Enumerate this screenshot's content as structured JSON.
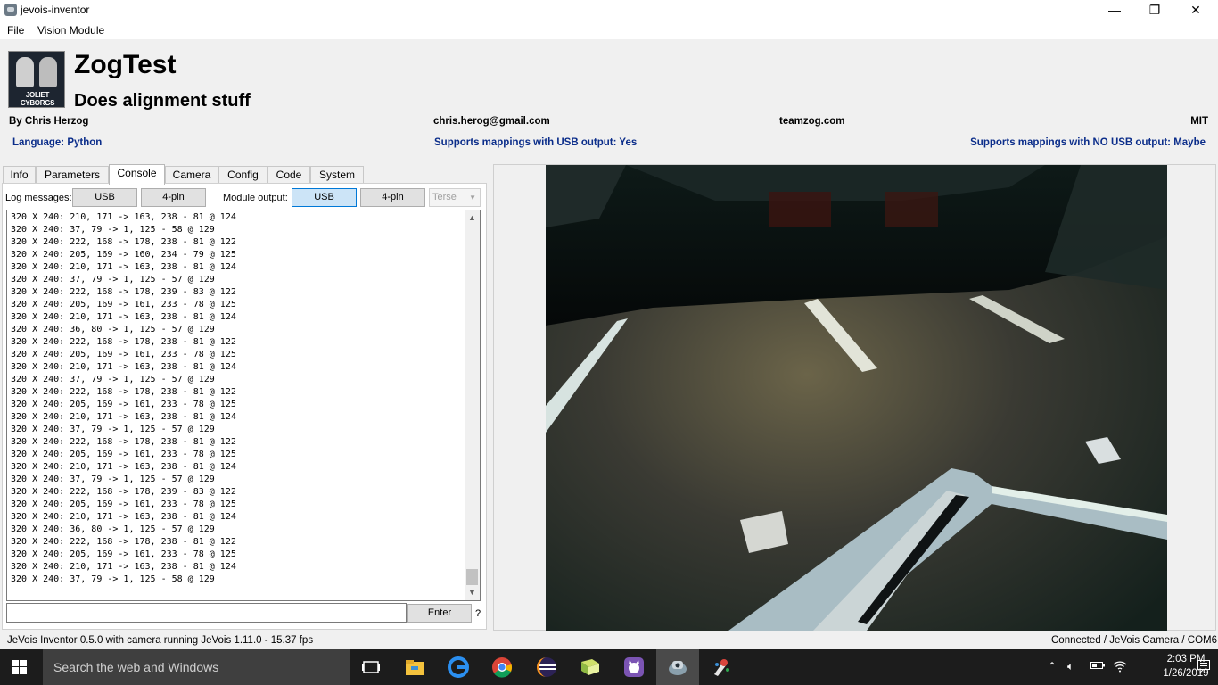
{
  "window": {
    "title": "jevois-inventor",
    "minimize": "—",
    "restore": "❐",
    "close": "✕"
  },
  "menu": [
    "File",
    "Vision Module"
  ],
  "module": {
    "name": "ZogTest",
    "description": "Does alignment stuff",
    "logo_text": "JOLIET CYBORGS",
    "author": "By Chris Herzog",
    "email": "chris.herog@gmail.com",
    "website": "teamzog.com",
    "license": "MIT",
    "language": "Language: Python",
    "usb_mappings": "Supports mappings with USB output: Yes",
    "nousb_mappings": "Supports mappings with NO USB output: Maybe"
  },
  "tabs": [
    "Info",
    "Parameters",
    "Console",
    "Camera",
    "Config",
    "Code",
    "System"
  ],
  "active_tab": "Console",
  "console": {
    "log_messages_label": "Log messages:",
    "log_usb": "USB",
    "log_4pin": "4-pin",
    "module_output_label": "Module output:",
    "out_usb": "USB",
    "out_4pin": "4-pin",
    "terse": "Terse",
    "lines": [
      "320 X 240: 210, 171 -> 163, 238 - 81 @ 124",
      "320 X 240: 37, 79 -> 1, 125 - 58 @ 129",
      "320 X 240: 222, 168 -> 178, 238 - 81 @ 122",
      "320 X 240: 205, 169 -> 160, 234 - 79 @ 125",
      "320 X 240: 210, 171 -> 163, 238 - 81 @ 124",
      "320 X 240: 37, 79 -> 1, 125 - 57 @ 129",
      "320 X 240: 222, 168 -> 178, 239 - 83 @ 122",
      "320 X 240: 205, 169 -> 161, 233 - 78 @ 125",
      "320 X 240: 210, 171 -> 163, 238 - 81 @ 124",
      "320 X 240: 36, 80 -> 1, 125 - 57 @ 129",
      "320 X 240: 222, 168 -> 178, 238 - 81 @ 122",
      "320 X 240: 205, 169 -> 161, 233 - 78 @ 125",
      "320 X 240: 210, 171 -> 163, 238 - 81 @ 124",
      "320 X 240: 37, 79 -> 1, 125 - 57 @ 129",
      "320 X 240: 222, 168 -> 178, 238 - 81 @ 122",
      "320 X 240: 205, 169 -> 161, 233 - 78 @ 125",
      "320 X 240: 210, 171 -> 163, 238 - 81 @ 124",
      "320 X 240: 37, 79 -> 1, 125 - 57 @ 129",
      "320 X 240: 222, 168 -> 178, 238 - 81 @ 122",
      "320 X 240: 205, 169 -> 161, 233 - 78 @ 125",
      "320 X 240: 210, 171 -> 163, 238 - 81 @ 124",
      "320 X 240: 37, 79 -> 1, 125 - 57 @ 129",
      "320 X 240: 222, 168 -> 178, 239 - 83 @ 122",
      "320 X 240: 205, 169 -> 161, 233 - 78 @ 125",
      "320 X 240: 210, 171 -> 163, 238 - 81 @ 124",
      "320 X 240: 36, 80 -> 1, 125 - 57 @ 129",
      "320 X 240: 222, 168 -> 178, 238 - 81 @ 122",
      "320 X 240: 205, 169 -> 161, 233 - 78 @ 125",
      "320 X 240: 210, 171 -> 163, 238 - 81 @ 124",
      "320 X 240: 37, 79 -> 1, 125 - 58 @ 129"
    ],
    "input_value": "",
    "enter_label": "Enter",
    "help_label": "?"
  },
  "status": {
    "left": "JeVois Inventor 0.5.0 with camera running JeVois 1.11.0 - 15.37 fps",
    "right": "Connected / JeVois Camera / COM6"
  },
  "taskbar": {
    "search_placeholder": "Search the web and Windows",
    "time": "2:03 PM",
    "date": "1/26/2019",
    "icons": [
      "windows-icon",
      "task-view-icon",
      "file-explorer-icon",
      "edge-icon",
      "chrome-icon",
      "eclipse-icon",
      "notepad-icon",
      "github-icon",
      "jevois-inventor-icon",
      "paint-icon"
    ]
  },
  "colors": {
    "info_blue": "#0b2d8a",
    "selected_button": "#cce4f7",
    "taskbar": "#1c1c1c"
  }
}
